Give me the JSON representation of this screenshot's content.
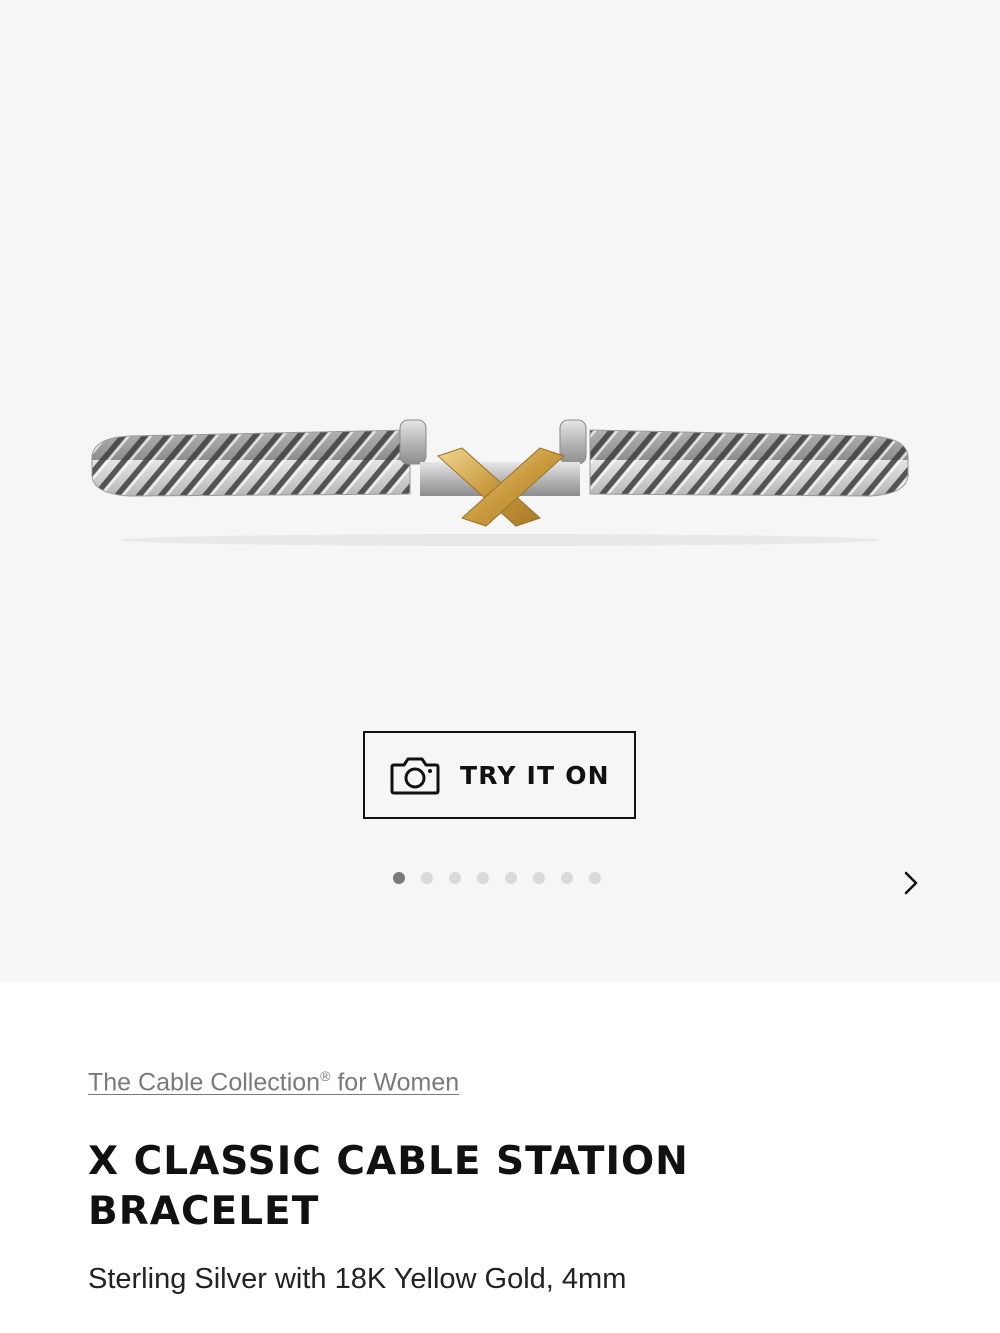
{
  "gallery": {
    "try_on_label": "TRY IT ON",
    "slide_count": 8,
    "active_slide": 1,
    "background_color": "#f6f6f6",
    "icons": {
      "try_on": "camera-icon",
      "next": "chevron-right-icon"
    }
  },
  "product": {
    "collection_link_text": "The Cable Collection",
    "collection_link_mark": "®",
    "collection_link_suffix": " for Women",
    "title": "X CLASSIC CABLE STATION BRACELET",
    "subtitle": "Sterling Silver with 18K Yellow Gold, 4mm",
    "colors": {
      "silver": "#c9c9c9",
      "gold": "#d4af5f"
    }
  }
}
